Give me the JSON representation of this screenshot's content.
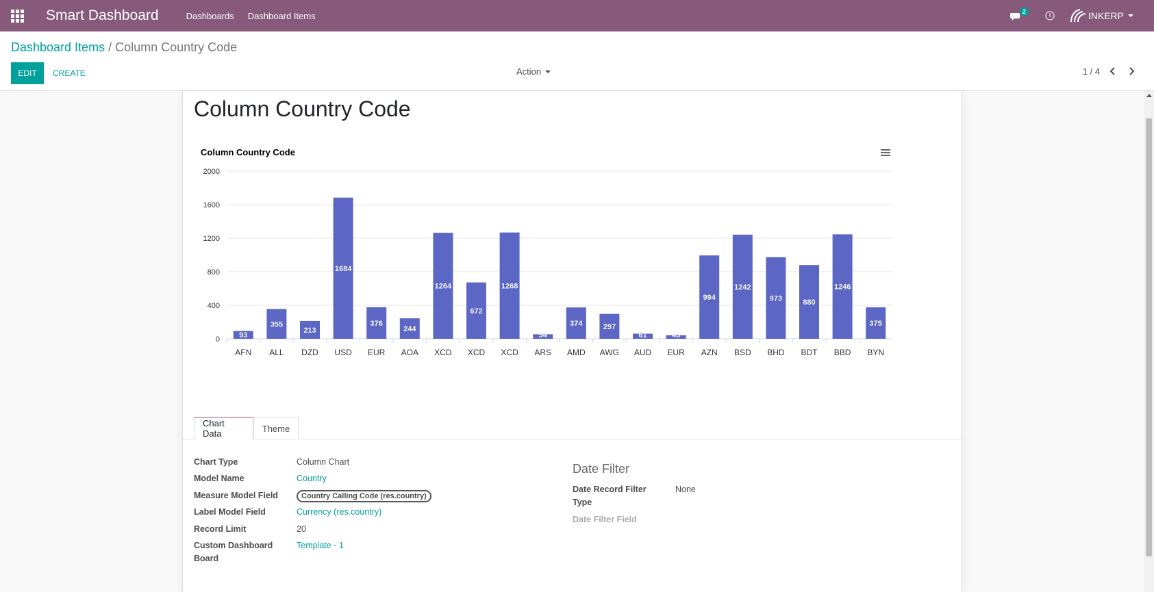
{
  "navbar": {
    "app_title": "Smart Dashboard",
    "menus": [
      "Dashboards",
      "Dashboard Items"
    ],
    "chat_count": "2",
    "company": "INKERP"
  },
  "breadcrumb": {
    "parent": "Dashboard Items",
    "separator": "/",
    "current": "Column Country Code"
  },
  "toolbar": {
    "edit_label": "EDIT",
    "create_label": "CREATE",
    "action_label": "Action",
    "pager": "1 / 4"
  },
  "record": {
    "title": "Column Country Code"
  },
  "chart_data": {
    "type": "bar",
    "title": "Column Country Code",
    "categories": [
      "AFN",
      "ALL",
      "DZD",
      "USD",
      "EUR",
      "AOA",
      "XCD",
      "XCD",
      "XCD",
      "ARS",
      "AMD",
      "AWG",
      "AUD",
      "EUR",
      "AZN",
      "BSD",
      "BHD",
      "BDT",
      "BBD",
      "BYN"
    ],
    "values": [
      93,
      355,
      213,
      1684,
      376,
      244,
      1264,
      672,
      1268,
      54,
      374,
      297,
      61,
      43,
      994,
      1242,
      973,
      880,
      1246,
      375
    ],
    "ylim": [
      0,
      2000
    ],
    "yticks": [
      0,
      400,
      800,
      1200,
      1600,
      2000
    ],
    "data_labels": true,
    "grid": true,
    "color": "#5c66c4"
  },
  "tabs": {
    "chart_data": "Chart Data",
    "theme": "Theme"
  },
  "fields": {
    "chart_type_label": "Chart Type",
    "chart_type_value": "Column Chart",
    "model_name_label": "Model Name",
    "model_name_value": "Country",
    "measure_label": "Measure Model Field",
    "measure_value": "Country Calling Code (res.country)",
    "label_field_label": "Label Model Field",
    "label_field_value": "Currency (res.country)",
    "record_limit_label": "Record Limit",
    "record_limit_value": "20",
    "custom_board_label_1": "Custom Dashboard",
    "custom_board_label_2": "Board",
    "custom_board_value": "Template - 1",
    "date_filter_title": "Date Filter",
    "date_record_filter_label_1": "Date Record Filter",
    "date_record_filter_label_2": "Type",
    "date_record_filter_value": "None",
    "date_filter_field_label": "Date Filter Field"
  }
}
